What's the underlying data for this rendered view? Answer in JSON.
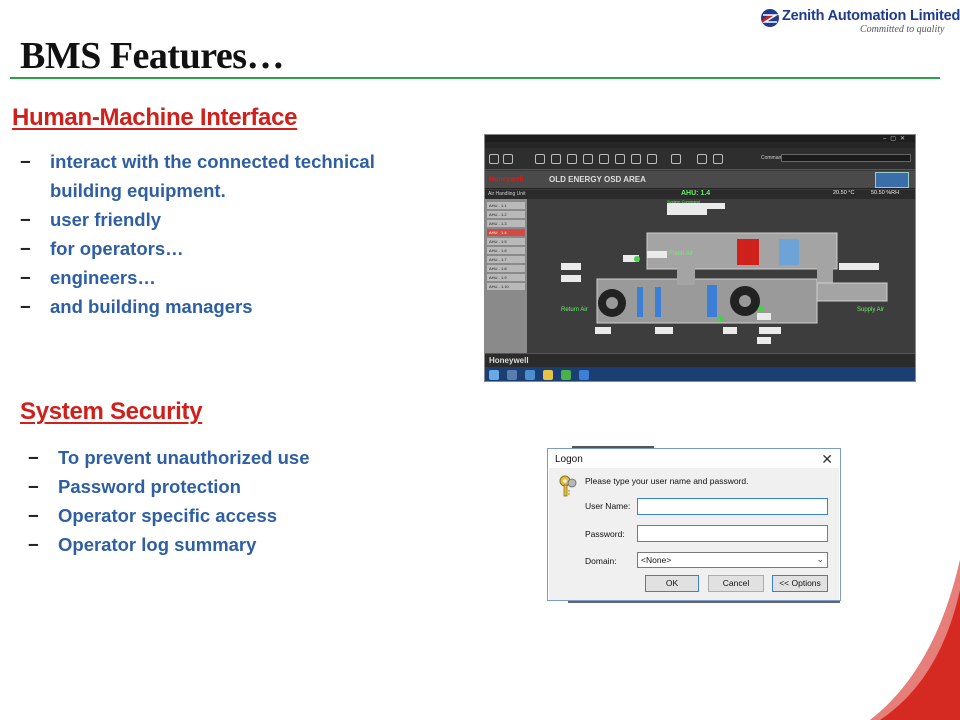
{
  "logo": {
    "name": "Zenith Automation Limited",
    "tagline": "Committed to quality"
  },
  "title": "BMS Features…",
  "colors": {
    "heading_red": "#d0201b",
    "bullet_blue": "#2e5fa3",
    "rule_green": "#2ba14a",
    "brand_navy": "#1f3b8f"
  },
  "hmi": {
    "heading": "Human-Machine Interface",
    "bullets": [
      "interact with the connected technical building equipment.",
      "user friendly",
      "for operators…",
      "engineers…",
      "and building managers"
    ],
    "screenshot": {
      "brand": "Honeywell",
      "area_title": "OLD ENERGY OSD AREA",
      "sidebar_header": "Air Handling Unit",
      "ahu_label": "AHU: 1.4",
      "temperature": "20.50 °C",
      "humidity": "50.50 %RH",
      "fresh_air": "Fresh Air",
      "return_air": "Return Air",
      "supply_air": "Supply Air",
      "system_command": "System Command",
      "command_label": "Command",
      "status_brand": "Honeywell",
      "sidebar_items": [
        "AHU - 1.1",
        "AHU - 1.2",
        "AHU - 1.3",
        "AHU - 1.4",
        "AHU - 1.5",
        "AHU - 1.6",
        "AHU - 1.7",
        "AHU - 1.8",
        "AHU - 1.9",
        "AHU - 1.10"
      ],
      "active_item_index": 3
    }
  },
  "security": {
    "heading": "System Security",
    "bullets": [
      "To prevent unauthorized use",
      "Password protection",
      "Operator specific access",
      "Operator log summary"
    ]
  },
  "logon": {
    "title": "Logon",
    "prompt": "Please type your user name and password.",
    "user_label": "User Name:",
    "user_value": "",
    "password_label": "Password:",
    "password_value": "",
    "domain_label": "Domain:",
    "domain_value": "<None>",
    "ok": "OK",
    "cancel": "Cancel",
    "options": "<< Options",
    "close_glyph": "✕"
  },
  "dash_glyph": "−"
}
